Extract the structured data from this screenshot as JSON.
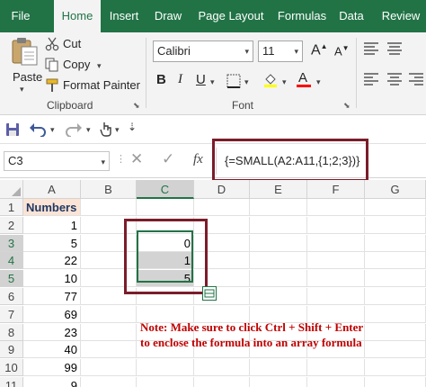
{
  "tabs": [
    "File",
    "Home",
    "Insert",
    "Draw",
    "Page Layout",
    "Formulas",
    "Data",
    "Review"
  ],
  "active_tab": "Home",
  "clipboard": {
    "paste": "Paste",
    "cut": "Cut",
    "copy": "Copy",
    "format_painter": "Format Painter",
    "group_label": "Clipboard"
  },
  "font": {
    "name": "Calibri",
    "size": "11",
    "group_label": "Font"
  },
  "name_box": "C3",
  "fx_label": "fx",
  "formula": "{=SMALL(A2:A11,{1;2;3})}",
  "columns": [
    "A",
    "B",
    "C",
    "D",
    "E",
    "F",
    "G"
  ],
  "selected_column": "C",
  "rows": [
    "1",
    "2",
    "3",
    "4",
    "5",
    "6",
    "7",
    "8",
    "9",
    "10",
    "11"
  ],
  "selected_rows": [
    "3",
    "4",
    "5"
  ],
  "column_a": [
    "Numbers",
    "1",
    "5",
    "22",
    "10",
    "77",
    "69",
    "23",
    "40",
    "99",
    "9"
  ],
  "column_c": {
    "3": "0",
    "4": "1",
    "5": "5"
  },
  "note": {
    "line1_prefix": "Note: Make sure to click ",
    "line1_keys": "Ctrl + Shift + Enter",
    "line2": "to enclose the formula into an array formula"
  },
  "colors": {
    "excel_green": "#217346",
    "highlight_border": "#7b1c2a",
    "header_fill": "#fbe4d5",
    "note_text": "#c00000"
  }
}
